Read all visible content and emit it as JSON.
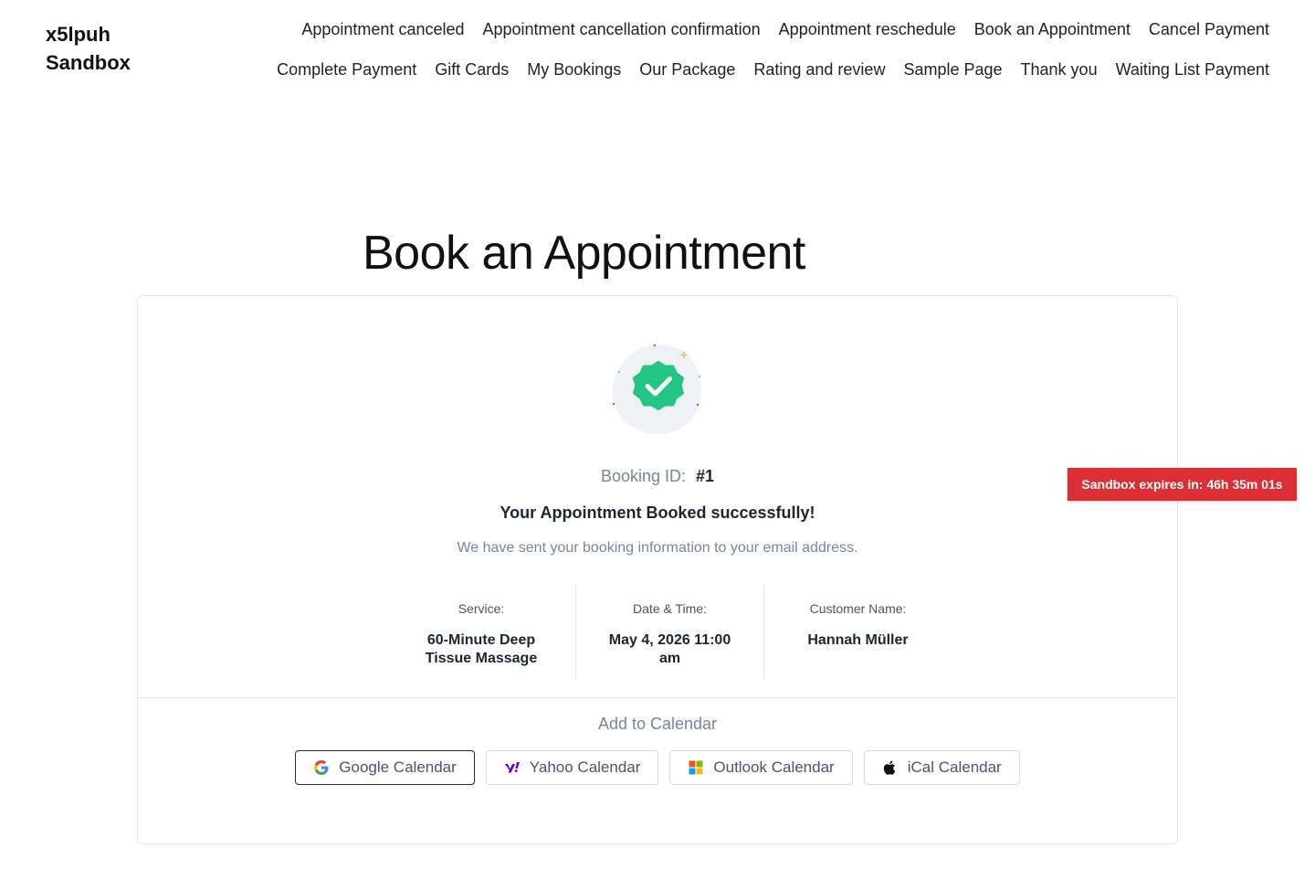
{
  "site": {
    "title_line1": "x5lpuh",
    "title_line2": "Sandbox"
  },
  "nav": {
    "items": [
      "Appointment canceled",
      "Appointment cancellation confirmation",
      "Appointment reschedule",
      "Book an Appointment",
      "Cancel Payment",
      "Complete Payment",
      "Gift Cards",
      "My Bookings",
      "Our Package",
      "Rating and review",
      "Sample Page",
      "Thank you",
      "Waiting List Payment"
    ]
  },
  "page": {
    "title": "Book an Appointment"
  },
  "confirmation": {
    "badge_icon": "verified-check-badge-icon",
    "badge_color": "#22c584",
    "booking_id_label": "Booking ID:",
    "booking_id_value": "#1",
    "success_message": "Your Appointment Booked successfully!",
    "email_note": "We have sent your booking information to your email address.",
    "details": [
      {
        "label": "Service:",
        "value": "60-Minute Deep Tissue Massage"
      },
      {
        "label": "Date & Time:",
        "value": "May 4, 2026 11:00 am"
      },
      {
        "label": "Customer Name:",
        "value": "Hannah Müller"
      }
    ]
  },
  "calendar": {
    "heading": "Add to Calendar",
    "buttons": [
      {
        "label": "Google Calendar",
        "icon": "google-icon"
      },
      {
        "label": "Yahoo Calendar",
        "icon": "yahoo-icon"
      },
      {
        "label": "Outlook Calendar",
        "icon": "microsoft-icon"
      },
      {
        "label": "iCal Calendar",
        "icon": "apple-icon"
      }
    ]
  },
  "sandbox": {
    "banner_text": "Sandbox expires in: 46h 35m 01s",
    "banner_color": "#dc2f35"
  }
}
